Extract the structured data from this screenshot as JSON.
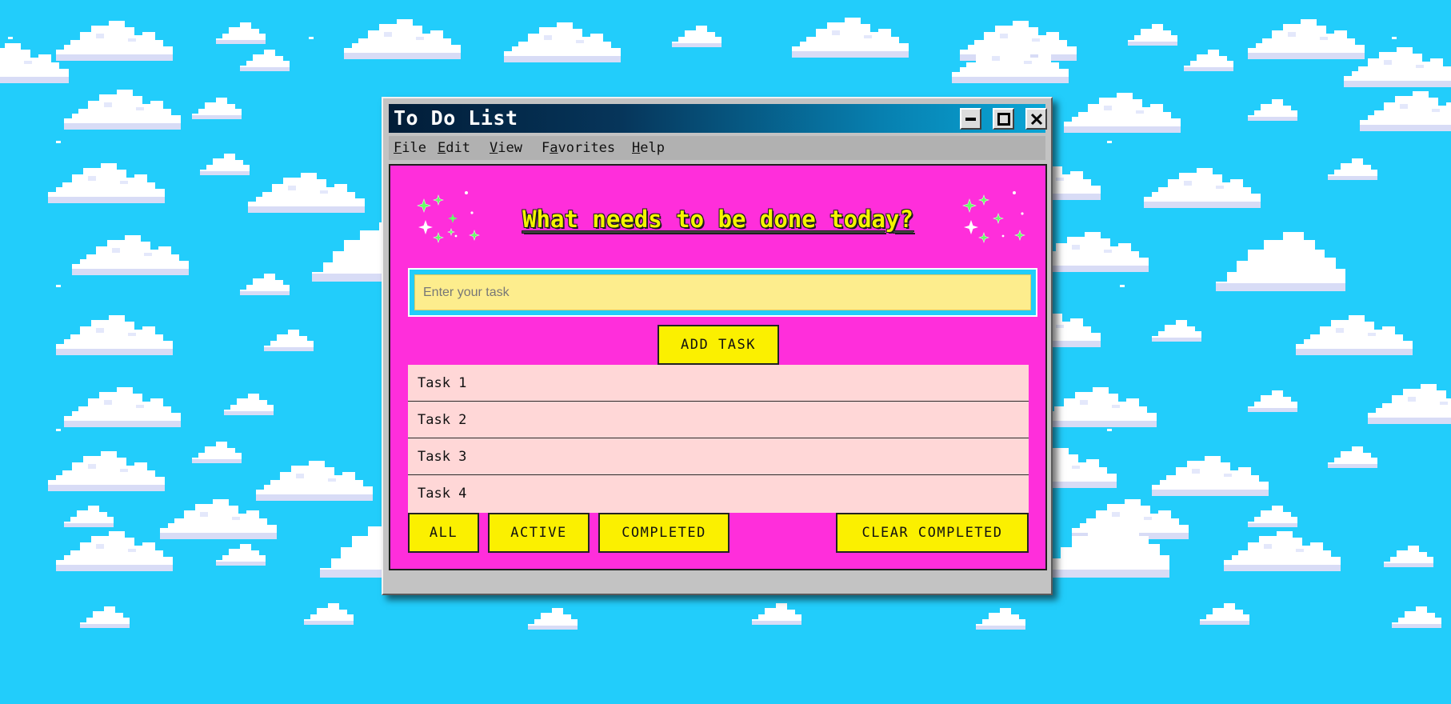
{
  "window": {
    "title": "To Do List",
    "controls": {
      "minimize": "minimize-icon",
      "maximize": "maximize-icon",
      "close": "close-icon"
    }
  },
  "menubar": {
    "items": [
      {
        "label_mnemonic": "F",
        "label_rest": "ile"
      },
      {
        "label_mnemonic": "E",
        "label_rest": "dit"
      },
      {
        "label_mnemonic": "V",
        "label_rest": "iew"
      },
      {
        "label_prefix": "F",
        "label_mnemonic": "a",
        "label_rest": "vorites"
      },
      {
        "label_mnemonic": "H",
        "label_rest": "elp"
      }
    ]
  },
  "app": {
    "heading": "What needs to be done today?",
    "input": {
      "placeholder": "Enter your task",
      "value": ""
    },
    "add_button": "ADD TASK",
    "tasks": [
      {
        "text": "Task 1"
      },
      {
        "text": "Task 2"
      },
      {
        "text": "Task 3"
      },
      {
        "text": "Task 4"
      }
    ],
    "filters": {
      "all": "ALL",
      "active": "ACTIVE",
      "completed": "COMPLETED"
    },
    "clear_button": "CLEAR COMPLETED"
  },
  "colors": {
    "sky": "#22cdfb",
    "panel": "#ff2edb",
    "button": "#fbf000",
    "task_row": "#ffd7d7",
    "input_bg": "#fded8d",
    "heading": "#f4f400",
    "sparkle": "#66ff66"
  },
  "decorations": {
    "background": "pixel-clouds",
    "sparkles": "sparkle-icon"
  }
}
